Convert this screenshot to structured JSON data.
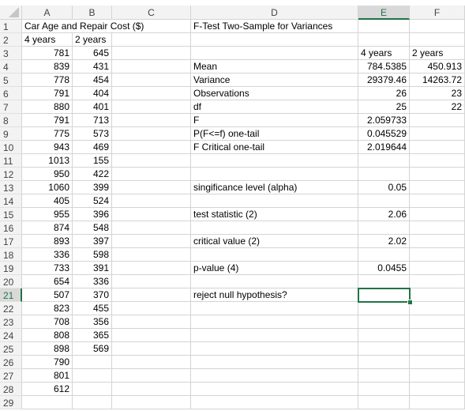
{
  "columns": [
    "A",
    "B",
    "C",
    "D",
    "E",
    "F"
  ],
  "selected_column": "E",
  "selected_row": 21,
  "rows": [
    1,
    2,
    3,
    4,
    5,
    6,
    7,
    8,
    9,
    10,
    11,
    12,
    13,
    14,
    15,
    16,
    17,
    18,
    19,
    20,
    21,
    22,
    23,
    24,
    25,
    26,
    27,
    28,
    29
  ],
  "data_table": {
    "title": "Car Age and Repair Cost ($)",
    "headers": [
      "4 years",
      "2 years"
    ],
    "four_years": [
      781,
      839,
      778,
      791,
      880,
      791,
      775,
      943,
      1013,
      950,
      1060,
      405,
      955,
      874,
      893,
      336,
      733,
      654,
      507,
      823,
      708,
      808,
      898,
      790,
      801,
      612
    ],
    "two_years": [
      645,
      431,
      454,
      404,
      401,
      713,
      573,
      469,
      155,
      422,
      399,
      524,
      396,
      548,
      397,
      598,
      391,
      336,
      370,
      455,
      356,
      365,
      569
    ]
  },
  "ftest": {
    "title": "F-Test Two-Sample for Variances",
    "col_headers": [
      "4 years",
      "2 years"
    ],
    "rows": [
      {
        "label": "Mean",
        "e": "784.5385",
        "f": "450.913"
      },
      {
        "label": "Variance",
        "e": "29379.46",
        "f": "14263.72"
      },
      {
        "label": "Observations",
        "e": "26",
        "f": "23"
      },
      {
        "label": "df",
        "e": "25",
        "f": "22"
      },
      {
        "label": "F",
        "e": "2.059733",
        "f": ""
      },
      {
        "label": "P(F<=f) one-tail",
        "e": "0.045529",
        "f": ""
      },
      {
        "label": "F Critical one-tail",
        "e": "2.019644",
        "f": ""
      }
    ]
  },
  "summary": [
    {
      "row": 13,
      "label": "singificance level (alpha)",
      "value": "0.05"
    },
    {
      "row": 15,
      "label": "test statistic (2)",
      "value": "2.06"
    },
    {
      "row": 17,
      "label": "critical value (2)",
      "value": "2.02"
    },
    {
      "row": 19,
      "label": "p-value (4)",
      "value": "0.0455"
    },
    {
      "row": 21,
      "label": "reject null hypothesis?",
      "value": ""
    }
  ],
  "colors": {
    "accent": "#217346",
    "gridline": "#d4d4d4",
    "header_bg": "#f3f3f3"
  }
}
